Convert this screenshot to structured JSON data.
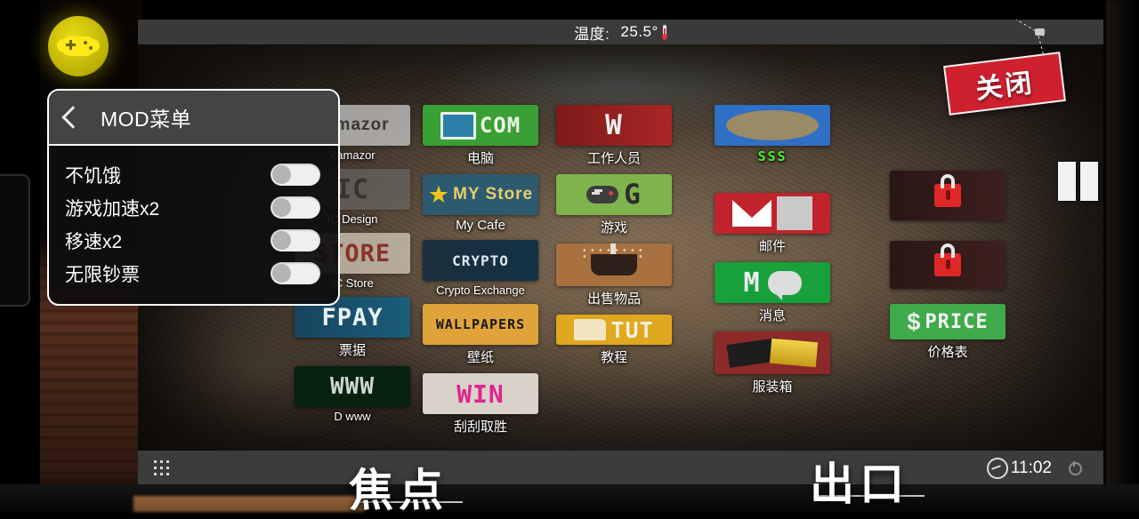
{
  "app": {
    "fab_icon": "gamepad-icon",
    "accent_yellow": "#e8dd14",
    "panel_bg": "#0e0e0e"
  },
  "mod_panel": {
    "back_icon": "chevron-left-icon",
    "title": "MOD菜单",
    "rows": [
      {
        "label": "不饥饿",
        "state": "off"
      },
      {
        "label": "游戏加速x2",
        "state": "off"
      },
      {
        "label": "移速x2",
        "state": "off"
      },
      {
        "label": "无限钞票",
        "state": "off"
      }
    ]
  },
  "game": {
    "topbar": {
      "temperature_label": "温度:",
      "temperature_value": "25.5°",
      "thermometer_icon": "thermometer-icon"
    },
    "close_sign": {
      "label": "关闭",
      "hook_icon": "hook-icon"
    },
    "bottombar": {
      "grid_icon": "app-grid-icon",
      "clock_icon": "clock-icon",
      "time": "11:02",
      "power_icon": "power-icon"
    },
    "overlays": [
      {
        "name": "focus-label",
        "text": "焦点"
      },
      {
        "name": "exit-label",
        "text": "出口"
      }
    ],
    "columns": [
      {
        "name": "column-1",
        "apps": [
          {
            "tile_class": "t-zam",
            "tile_text": "zamazor",
            "caption": "Zamazor",
            "icon": "zamazor-icon"
          },
          {
            "tile_class": "t-ic",
            "tile_text": "IC",
            "caption": "IC Design",
            "icon": "ic-design-icon"
          },
          {
            "tile_class": "t-store",
            "tile_text": "STORE",
            "caption": "IC Store",
            "icon": "ic-store-icon"
          },
          {
            "tile_class": "t-fpay",
            "tile_text": "FPAY",
            "caption": "票据",
            "icon": "fpay-icon"
          },
          {
            "tile_class": "t-www",
            "tile_text": "WWW",
            "caption": "D www",
            "icon": "www-icon"
          }
        ]
      },
      {
        "name": "column-2",
        "apps": [
          {
            "tile_class": "t-com",
            "tile_text": "COM",
            "caption": "电脑",
            "icon": "computer-icon"
          },
          {
            "tile_class": "t-my",
            "tile_text": "MY Store",
            "caption": "My Cafe",
            "icon": "my-store-icon"
          },
          {
            "tile_class": "t-crypto",
            "tile_text": "CRYPTO",
            "caption": "Crypto Exchange",
            "icon": "crypto-icon"
          },
          {
            "tile_class": "t-wall",
            "tile_text": "WALLPAPERS",
            "caption": "壁纸",
            "icon": "wallpapers-icon"
          },
          {
            "tile_class": "t-win",
            "tile_text": "WIN",
            "caption": "刮刮取胜",
            "icon": "scratch-win-icon"
          }
        ]
      },
      {
        "name": "column-3",
        "apps": [
          {
            "tile_class": "t-work",
            "tile_text": "W",
            "caption": "工作人员",
            "icon": "staff-icon"
          },
          {
            "tile_class": "t-game",
            "tile_text": "G",
            "caption": "游戏",
            "icon": "games-icon"
          },
          {
            "tile_class": "t-sell",
            "tile_text": "",
            "caption": "出售物品",
            "icon": "sell-items-icon"
          },
          {
            "tile_class": "t-tut",
            "tile_text": "TUT",
            "caption": "教程",
            "icon": "tutorial-icon"
          }
        ]
      },
      {
        "name": "column-4",
        "apps": [
          {
            "tile_class": "t-sss",
            "tile_text": "",
            "caption": "SSS",
            "icon": "sss-icon"
          },
          {
            "tile_class": "t-mail",
            "tile_text": "",
            "caption": "邮件",
            "icon": "mail-icon"
          },
          {
            "tile_class": "t-msg",
            "tile_text": "M",
            "caption": "消息",
            "icon": "message-icon"
          },
          {
            "tile_class": "t-cloth",
            "tile_text": "",
            "caption": "服装箱",
            "icon": "clothing-box-icon"
          }
        ]
      },
      {
        "name": "column-5",
        "apps": [
          {
            "tile_class": "t-lock",
            "tile_text": "",
            "caption": "",
            "icon": "locked-kitchen-icon"
          },
          {
            "tile_class": "t-lock",
            "tile_text": "",
            "caption": "",
            "icon": "locked-app-icon"
          },
          {
            "tile_class": "t-price",
            "tile_text": "PRICE",
            "caption": "价格表",
            "icon": "price-list-icon"
          }
        ]
      }
    ]
  }
}
